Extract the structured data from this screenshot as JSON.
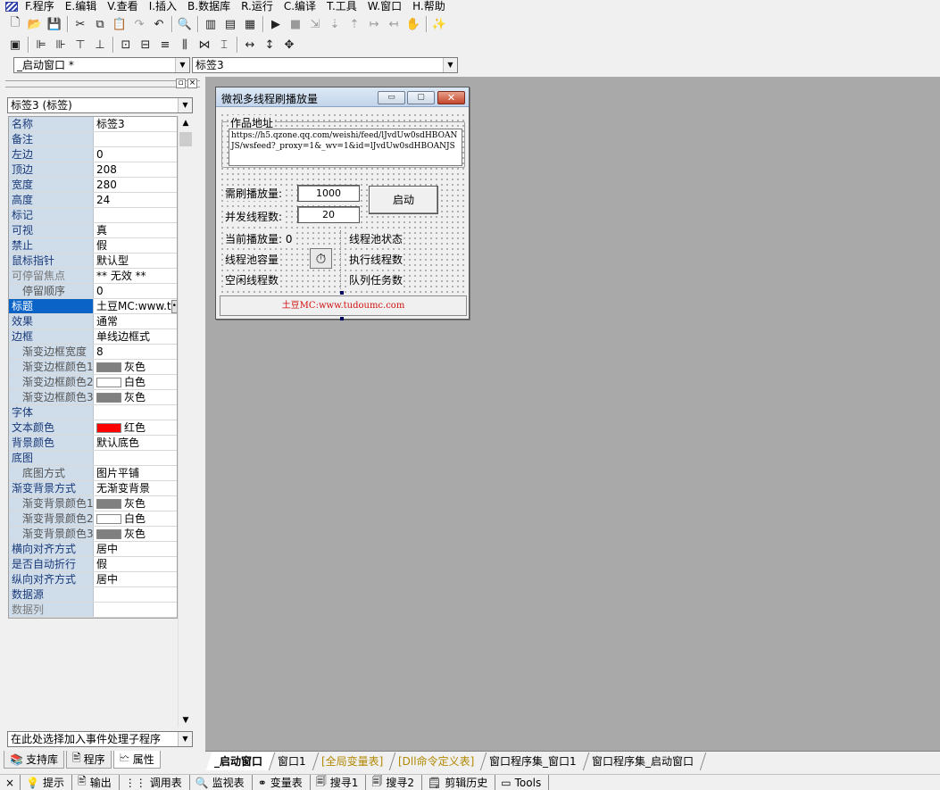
{
  "menu": [
    "F.程序",
    "E.编辑",
    "V.查看",
    "I.插入",
    "B.数据库",
    "R.运行",
    "C.编译",
    "T.工具",
    "W.窗口",
    "H.帮助"
  ],
  "toolbar1": [
    {
      "icon": "new-file-icon",
      "glyph": "🗋"
    },
    {
      "icon": "open-folder-icon",
      "glyph": "📂"
    },
    {
      "icon": "save-icon",
      "glyph": "💾"
    },
    {
      "sep": true
    },
    {
      "icon": "cut-icon",
      "glyph": "✂"
    },
    {
      "icon": "copy-icon",
      "glyph": "⧉"
    },
    {
      "icon": "paste-icon",
      "glyph": "📋",
      "dis": true
    },
    {
      "icon": "redo-icon",
      "glyph": "↷",
      "dis": true
    },
    {
      "icon": "undo-icon",
      "glyph": "↶"
    },
    {
      "sep": true
    },
    {
      "icon": "find-icon",
      "glyph": "🔍"
    },
    {
      "sep": true
    },
    {
      "icon": "layout-a-icon",
      "glyph": "▥"
    },
    {
      "icon": "layout-b-icon",
      "glyph": "▤"
    },
    {
      "icon": "layout-c-icon",
      "glyph": "▦"
    },
    {
      "sep": true
    },
    {
      "icon": "run-icon",
      "glyph": "▶"
    },
    {
      "icon": "stop-icon",
      "glyph": "■",
      "dis": true
    },
    {
      "icon": "step-a-icon",
      "glyph": "⇲",
      "dis": true
    },
    {
      "icon": "step-b-icon",
      "glyph": "⇣",
      "dis": true
    },
    {
      "icon": "step-c-icon",
      "glyph": "⇡",
      "dis": true
    },
    {
      "icon": "step-d-icon",
      "glyph": "↦",
      "dis": true
    },
    {
      "icon": "step-e-icon",
      "glyph": "↤",
      "dis": true
    },
    {
      "icon": "hand-icon",
      "glyph": "✋",
      "dis": true
    },
    {
      "sep": true
    },
    {
      "icon": "wizard-icon",
      "glyph": "✨"
    }
  ],
  "toolbar2": [
    {
      "icon": "form-icon",
      "glyph": "▣"
    },
    {
      "sep": true
    },
    {
      "icon": "align-left-icon",
      "glyph": "⊫"
    },
    {
      "icon": "align-right-icon",
      "glyph": "⊪"
    },
    {
      "icon": "align-top-icon",
      "glyph": "⊤"
    },
    {
      "icon": "align-bottom-icon",
      "glyph": "⊥"
    },
    {
      "sep": true
    },
    {
      "icon": "center-h-icon",
      "glyph": "⊡"
    },
    {
      "icon": "center-v-icon",
      "glyph": "⊟"
    },
    {
      "icon": "space-a-icon",
      "glyph": "≡"
    },
    {
      "icon": "space-b-icon",
      "glyph": "⫼"
    },
    {
      "icon": "space-c-icon",
      "glyph": "⋈"
    },
    {
      "icon": "space-d-icon",
      "glyph": "⌶"
    },
    {
      "sep": true
    },
    {
      "icon": "same-width-icon",
      "glyph": "↔"
    },
    {
      "icon": "same-height-icon",
      "glyph": "↕"
    },
    {
      "icon": "same-size-icon",
      "glyph": "✥"
    }
  ],
  "combos": {
    "window": "_启动窗口 *",
    "component": "标签3"
  },
  "panel": {
    "object_combo": "标签3 (标签)",
    "event_combo": "在此处选择加入事件处理子程序",
    "props": [
      {
        "name": "名称",
        "value": "标签3"
      },
      {
        "name": "备注",
        "value": ""
      },
      {
        "name": "左边",
        "value": "0"
      },
      {
        "name": "顶边",
        "value": "208"
      },
      {
        "name": "宽度",
        "value": "280"
      },
      {
        "name": "高度",
        "value": "24"
      },
      {
        "name": "标记",
        "value": ""
      },
      {
        "name": "可视",
        "value": "真"
      },
      {
        "name": "禁止",
        "value": "假"
      },
      {
        "name": "鼠标指针",
        "value": "默认型"
      },
      {
        "name": "可停留焦点",
        "value": "** 无效 **",
        "gray": true
      },
      {
        "name": "停留顺序",
        "value": "0",
        "sub": true
      },
      {
        "name": "标题",
        "value": "土豆MC:www.t",
        "sel": true,
        "ellipsis": true
      },
      {
        "name": "效果",
        "value": "通常"
      },
      {
        "name": "边框",
        "value": "单线边框式"
      },
      {
        "name": "渐变边框宽度",
        "value": "8",
        "sub": true
      },
      {
        "name": "渐变边框颜色1",
        "value": "灰色",
        "sub": true,
        "color": "#808080"
      },
      {
        "name": "渐变边框颜色2",
        "value": "白色",
        "sub": true,
        "color": "#ffffff"
      },
      {
        "name": "渐变边框颜色3",
        "value": "灰色",
        "sub": true,
        "color": "#808080"
      },
      {
        "name": "字体",
        "value": ""
      },
      {
        "name": "文本颜色",
        "value": "红色",
        "color": "#ff0000"
      },
      {
        "name": "背景颜色",
        "value": "默认底色"
      },
      {
        "name": "底图",
        "value": ""
      },
      {
        "name": "底图方式",
        "value": "图片平铺",
        "sub": true
      },
      {
        "name": "渐变背景方式",
        "value": "无渐变背景"
      },
      {
        "name": "渐变背景颜色1",
        "value": "灰色",
        "sub": true,
        "color": "#808080"
      },
      {
        "name": "渐变背景颜色2",
        "value": "白色",
        "sub": true,
        "color": "#ffffff"
      },
      {
        "name": "渐变背景颜色3",
        "value": "灰色",
        "sub": true,
        "color": "#808080"
      },
      {
        "name": "横向对齐方式",
        "value": "居中"
      },
      {
        "name": "是否自动折行",
        "value": "假"
      },
      {
        "name": "纵向对齐方式",
        "value": "居中"
      },
      {
        "name": "数据源",
        "value": ""
      },
      {
        "name": "数据列",
        "value": "",
        "gray": true
      }
    ],
    "tabs": [
      {
        "label": "支持库",
        "icon": "library-icon",
        "glyph": "📚"
      },
      {
        "label": "程序",
        "icon": "program-icon",
        "glyph": "🖹"
      },
      {
        "label": "属性",
        "icon": "properties-icon",
        "glyph": "🗠",
        "active": true
      }
    ]
  },
  "form": {
    "title": "微视多线程刷播放量",
    "group_label": "作品地址",
    "url": "https://h5.qzone.qq.com/weishi/feed/lJvdUw0sdHBOANJS/wsfeed?_proxy=1&_wv=1&id=lJvdUw0sdHBOANJS",
    "label_target": "需刷播放量:",
    "target_value": "1000",
    "label_threads": "并发线程数:",
    "threads_value": "20",
    "start_button": "启动",
    "label_current": "当前播放量: 0",
    "label_pool_capacity": "线程池容量",
    "label_idle": "空闲线程数",
    "label_pool_status": "线程池状态",
    "label_running": "执行线程数",
    "label_queue": "队列任务数",
    "link_text": "土豆MC:www.tudoumc.com",
    "link_color": "#d01010"
  },
  "worktabs": [
    {
      "label": "_启动窗口",
      "active": true
    },
    {
      "label": "窗口1"
    },
    {
      "label": "[全局变量表]",
      "color": "#b08800"
    },
    {
      "label": "[Dll命令定义表]",
      "color": "#b08800"
    },
    {
      "label": "窗口程序集_窗口1"
    },
    {
      "label": "窗口程序集_启动窗口"
    }
  ],
  "status": [
    {
      "label": "提示",
      "icon": "hint-icon",
      "glyph": "💡"
    },
    {
      "label": "输出",
      "icon": "output-icon",
      "glyph": "🖹"
    },
    {
      "label": "调用表",
      "icon": "callstack-icon",
      "glyph": "⋮⋮"
    },
    {
      "label": "监视表",
      "icon": "watch-icon",
      "glyph": "🔍"
    },
    {
      "label": "变量表",
      "icon": "variables-icon",
      "glyph": "⚭"
    },
    {
      "label": "搜寻1",
      "icon": "search1-icon",
      "glyph": "🗐"
    },
    {
      "label": "搜寻2",
      "icon": "search2-icon",
      "glyph": "🗐"
    },
    {
      "label": "剪辑历史",
      "icon": "clip-history-icon",
      "glyph": "🗒"
    },
    {
      "label": "Tools",
      "icon": "tools-icon",
      "glyph": "▭"
    }
  ]
}
